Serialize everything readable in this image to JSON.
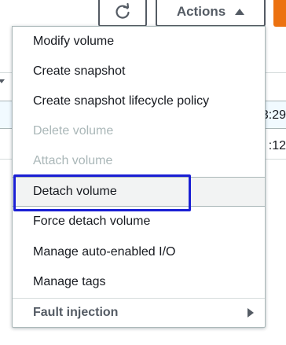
{
  "toolbar": {
    "refresh_icon": "refresh-icon",
    "actions_label": "Actions",
    "actions_caret_icon": "caret-up-icon"
  },
  "background": {
    "row1_time": "3:29",
    "row2_time": ":12"
  },
  "menu": {
    "items": [
      {
        "label": "Modify volume",
        "enabled": true
      },
      {
        "label": "Create snapshot",
        "enabled": true
      },
      {
        "label": "Create snapshot lifecycle policy",
        "enabled": true
      },
      {
        "label": "Delete volume",
        "enabled": false
      },
      {
        "label": "Attach volume",
        "enabled": false
      },
      {
        "label": "Detach volume",
        "enabled": true,
        "highlighted": true
      },
      {
        "label": "Force detach volume",
        "enabled": true
      },
      {
        "label": "Manage auto-enabled I/O",
        "enabled": true
      },
      {
        "label": "Manage tags",
        "enabled": true
      }
    ],
    "group": {
      "label": "Fault injection",
      "icon": "caret-right-icon"
    }
  },
  "colors": {
    "accent_orange": "#ec7211",
    "focus_ring": "#1a1fd4",
    "disabled_text": "#aab7b8",
    "button_border": "#545b64"
  }
}
